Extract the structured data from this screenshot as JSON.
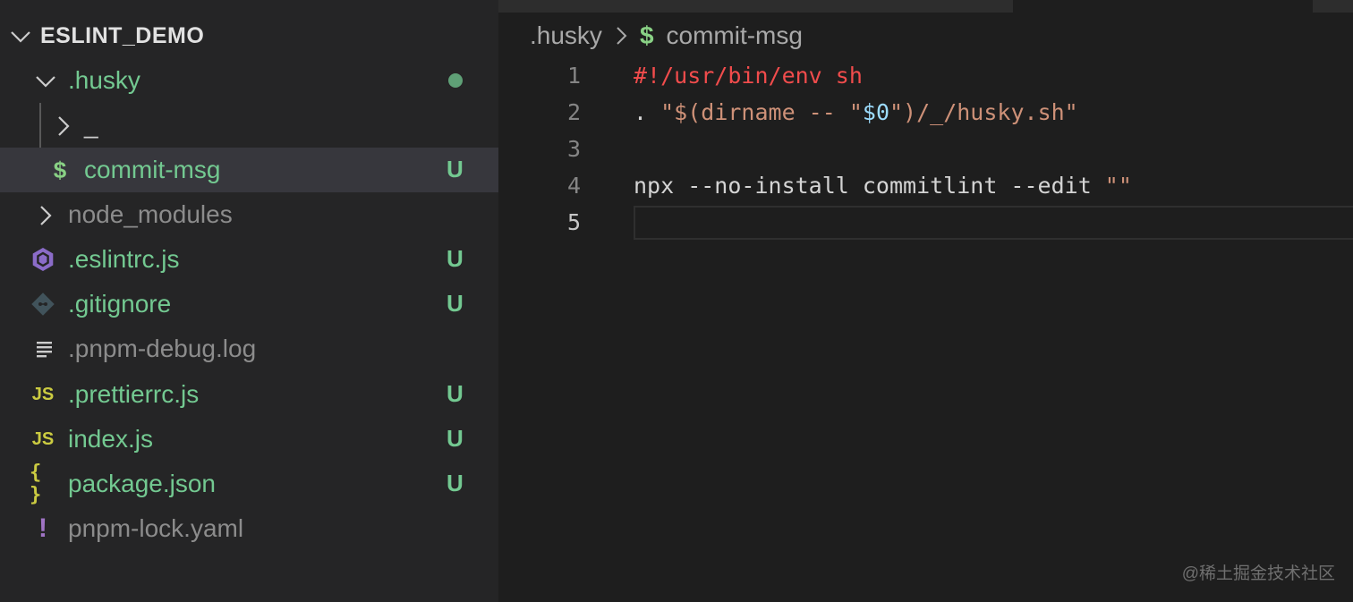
{
  "explorer": {
    "root": "ESLINT_DEMO",
    "items": [
      {
        "label": ".husky",
        "status": ""
      },
      {
        "label": "_",
        "status": ""
      },
      {
        "label": "commit-msg",
        "status": "U"
      },
      {
        "label": "node_modules",
        "status": ""
      },
      {
        "label": ".eslintrc.js",
        "status": "U"
      },
      {
        "label": ".gitignore",
        "status": "U"
      },
      {
        "label": ".pnpm-debug.log",
        "status": ""
      },
      {
        "label": ".prettierrc.js",
        "status": "U"
      },
      {
        "label": "index.js",
        "status": "U"
      },
      {
        "label": "package.json",
        "status": "U"
      },
      {
        "label": "pnpm-lock.yaml",
        "status": ""
      }
    ],
    "icons": {
      "js": "JS",
      "json": "{ }",
      "sh": "$",
      "yaml": "!"
    }
  },
  "breadcrumb": {
    "folder": ".husky",
    "separator": ">",
    "file_icon": "$",
    "file": "commit-msg"
  },
  "editor": {
    "line_numbers": [
      "1",
      "2",
      "3",
      "4",
      "5"
    ],
    "lines": {
      "l1": "#!/usr/bin/env sh",
      "l2_a": ". ",
      "l2_b": "\"$(dirname -- \"",
      "l2_c": "$0",
      "l2_d": "\")/_/husky.sh\"",
      "l4_a": "npx --no-install commitlint --edit ",
      "l4_b": "\"\""
    }
  },
  "watermark": "@稀土掘金技术社区",
  "colors": {
    "untracked": "#73c991",
    "comment_red": "#f14c4c",
    "string": "#ce9178",
    "variable": "#9cdcfe",
    "sh_icon": "#89d185",
    "js_icon": "#cbcb41",
    "eslint_icon": "#8b6cc8"
  }
}
